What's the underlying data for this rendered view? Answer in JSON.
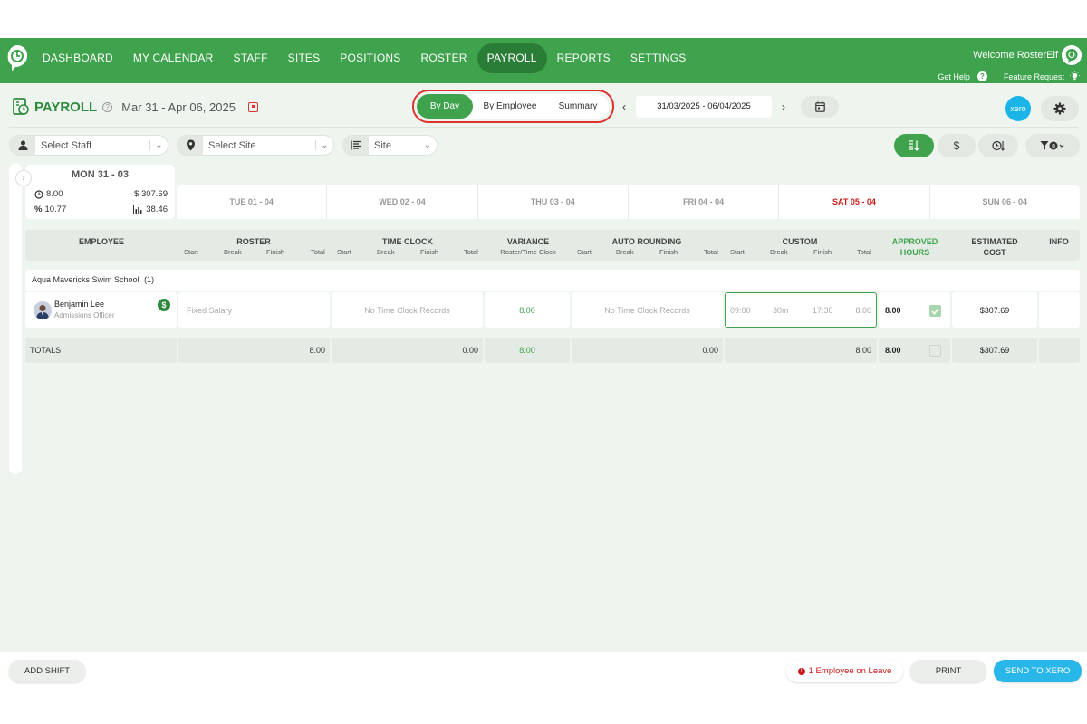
{
  "nav": {
    "items": [
      {
        "label": "DASHBOARD",
        "active": false
      },
      {
        "label": "MY CALENDAR",
        "active": false
      },
      {
        "label": "STAFF",
        "active": false
      },
      {
        "label": "SITES",
        "active": false
      },
      {
        "label": "POSITIONS",
        "active": false
      },
      {
        "label": "ROSTER",
        "active": false
      },
      {
        "label": "PAYROLL",
        "active": true
      },
      {
        "label": "REPORTS",
        "active": false
      },
      {
        "label": "SETTINGS",
        "active": false
      }
    ],
    "welcome": "Welcome RosterElf",
    "get_help": "Get Help",
    "feature_request": "Feature Request"
  },
  "header": {
    "title": "PAYROLL",
    "date_title": "Mar 31 - Apr 06, 2025",
    "views": [
      {
        "label": "By Day",
        "active": true
      },
      {
        "label": "By Employee",
        "active": false
      },
      {
        "label": "Summary",
        "active": false
      }
    ],
    "date_range": "31/03/2025 - 06/04/2025",
    "xero_label": "xero"
  },
  "filters": {
    "staff_placeholder": "Select Staff",
    "site_placeholder": "Select Site",
    "group_by": "Site"
  },
  "mon_card": {
    "title": "MON 31 - 03",
    "hours": "8.00",
    "cost": "$ 307.69",
    "percent": "10.77",
    "chart_value": "38.46"
  },
  "days": [
    {
      "label": "TUE 01 - 04",
      "weekend": false
    },
    {
      "label": "WED 02 - 04",
      "weekend": false
    },
    {
      "label": "THU 03 - 04",
      "weekend": false
    },
    {
      "label": "FRI 04 - 04",
      "weekend": false
    },
    {
      "label": "SAT 05 - 04",
      "weekend": true
    },
    {
      "label": "SUN 06 - 04",
      "weekend": false
    }
  ],
  "table": {
    "headers": {
      "employee": "EMPLOYEE",
      "roster": "ROSTER",
      "time_clock": "TIME CLOCK",
      "variance": "VARIANCE",
      "variance_sub": "Roster/Time Clock",
      "auto_rounding": "AUTO ROUNDING",
      "custom": "CUSTOM",
      "approved": "APPROVED",
      "approved_2": "HOURS",
      "estimated": "ESTIMATED",
      "estimated_2": "COST",
      "info": "INFO",
      "start": "Start",
      "break": "Break",
      "finish": "Finish",
      "total": "Total"
    },
    "group": "Aqua Mavericks Swim School",
    "group_count": "(1)",
    "row": {
      "name": "Benjamin Lee",
      "position": "Admissions Officer",
      "roster": "Fixed Salary",
      "time_clock": "No Time Clock Records",
      "variance": "8.00",
      "auto_rounding": "No Time Clock Records",
      "custom_start": "09:00",
      "custom_break": "30m",
      "custom_finish": "17:30",
      "custom_total": "8.00",
      "approved": "8.00",
      "cost": "$307.69"
    },
    "totals": {
      "label": "TOTALS",
      "roster": "8.00",
      "time_clock": "0.00",
      "variance": "8.00",
      "auto_rounding": "0.00",
      "custom": "8.00",
      "approved": "8.00",
      "cost": "$307.69"
    }
  },
  "footer": {
    "add_shift": "ADD SHIFT",
    "leave": "1 Employee on Leave",
    "print": "PRINT",
    "send": "SEND TO XERO"
  },
  "colors": {
    "brand": "#3fa34d",
    "brand_dark": "#2a7d36",
    "alert": "#e0312d",
    "xero": "#1ab4e8"
  }
}
